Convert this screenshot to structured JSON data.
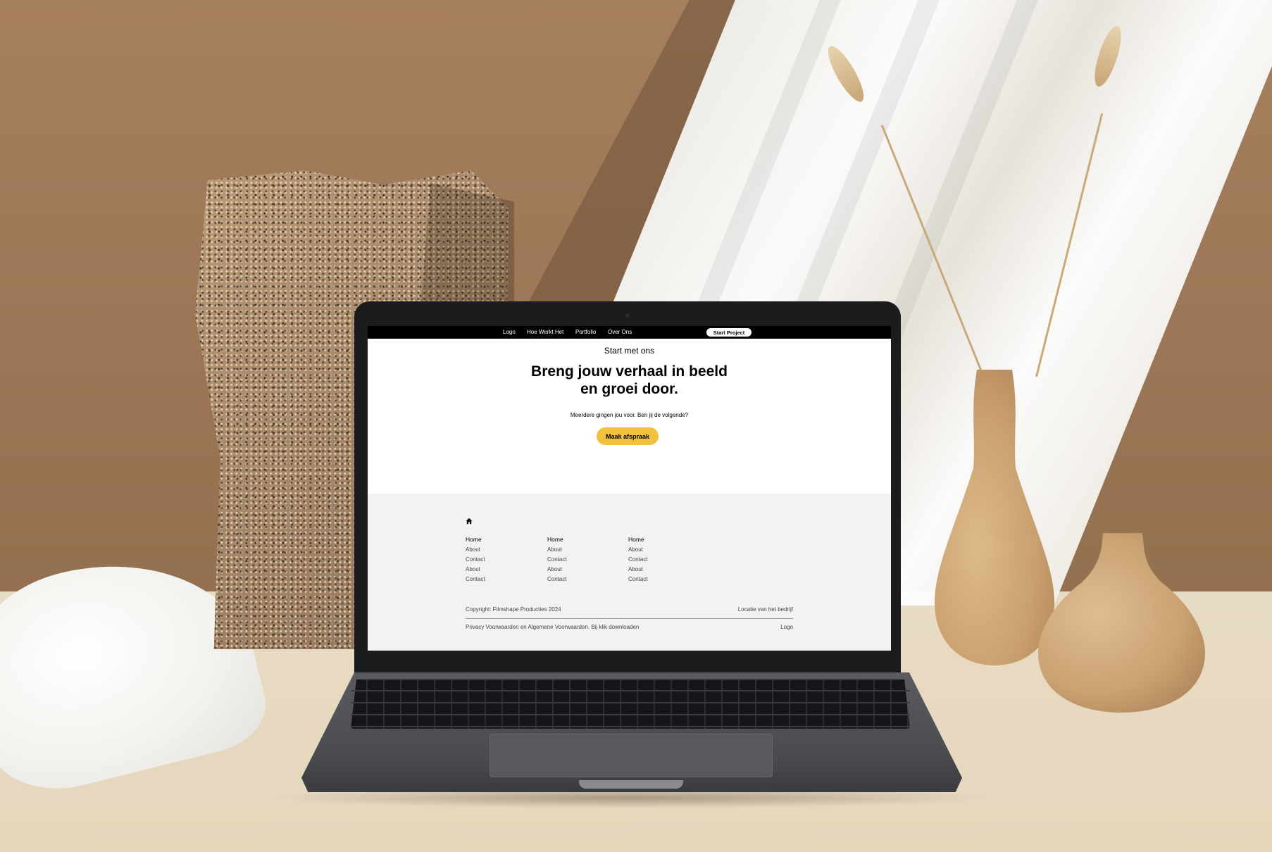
{
  "nav": {
    "items": [
      {
        "label": "Logo"
      },
      {
        "label": "Hoe Werkt Het"
      },
      {
        "label": "Portfolio"
      },
      {
        "label": "Over Ons"
      }
    ],
    "cta_label": "Start Project"
  },
  "hero": {
    "eyebrow": "Start met ons",
    "headline_line1": "Breng jouw verhaal in beeld",
    "headline_line2": "en groei door.",
    "subtext": "Meerdere gingen jou voor. Ben jij de volgende?",
    "button_label": "Maak afspraak"
  },
  "footer": {
    "home_icon": "home-icon",
    "columns": [
      {
        "heading": "Home",
        "links": [
          "About",
          "Contact",
          "About",
          "Contact"
        ]
      },
      {
        "heading": "Home",
        "links": [
          "About",
          "Contact",
          "About",
          "Contact"
        ]
      },
      {
        "heading": "Home",
        "links": [
          "About",
          "Contact",
          "About",
          "Contact"
        ]
      }
    ],
    "copyright": "Copyright: Filmshape Producties 2024",
    "location": "Locatie van het bedrijf",
    "privacy": "Privacy Voorwaarden en Algemene Voorwaarden. Bij klik downloaden",
    "logo": "Logo"
  },
  "colors": {
    "nav_bg": "#000000",
    "cta_bg": "#ffffff",
    "accent_button": "#f0c03e",
    "footer_bg": "#f2f2f2"
  }
}
